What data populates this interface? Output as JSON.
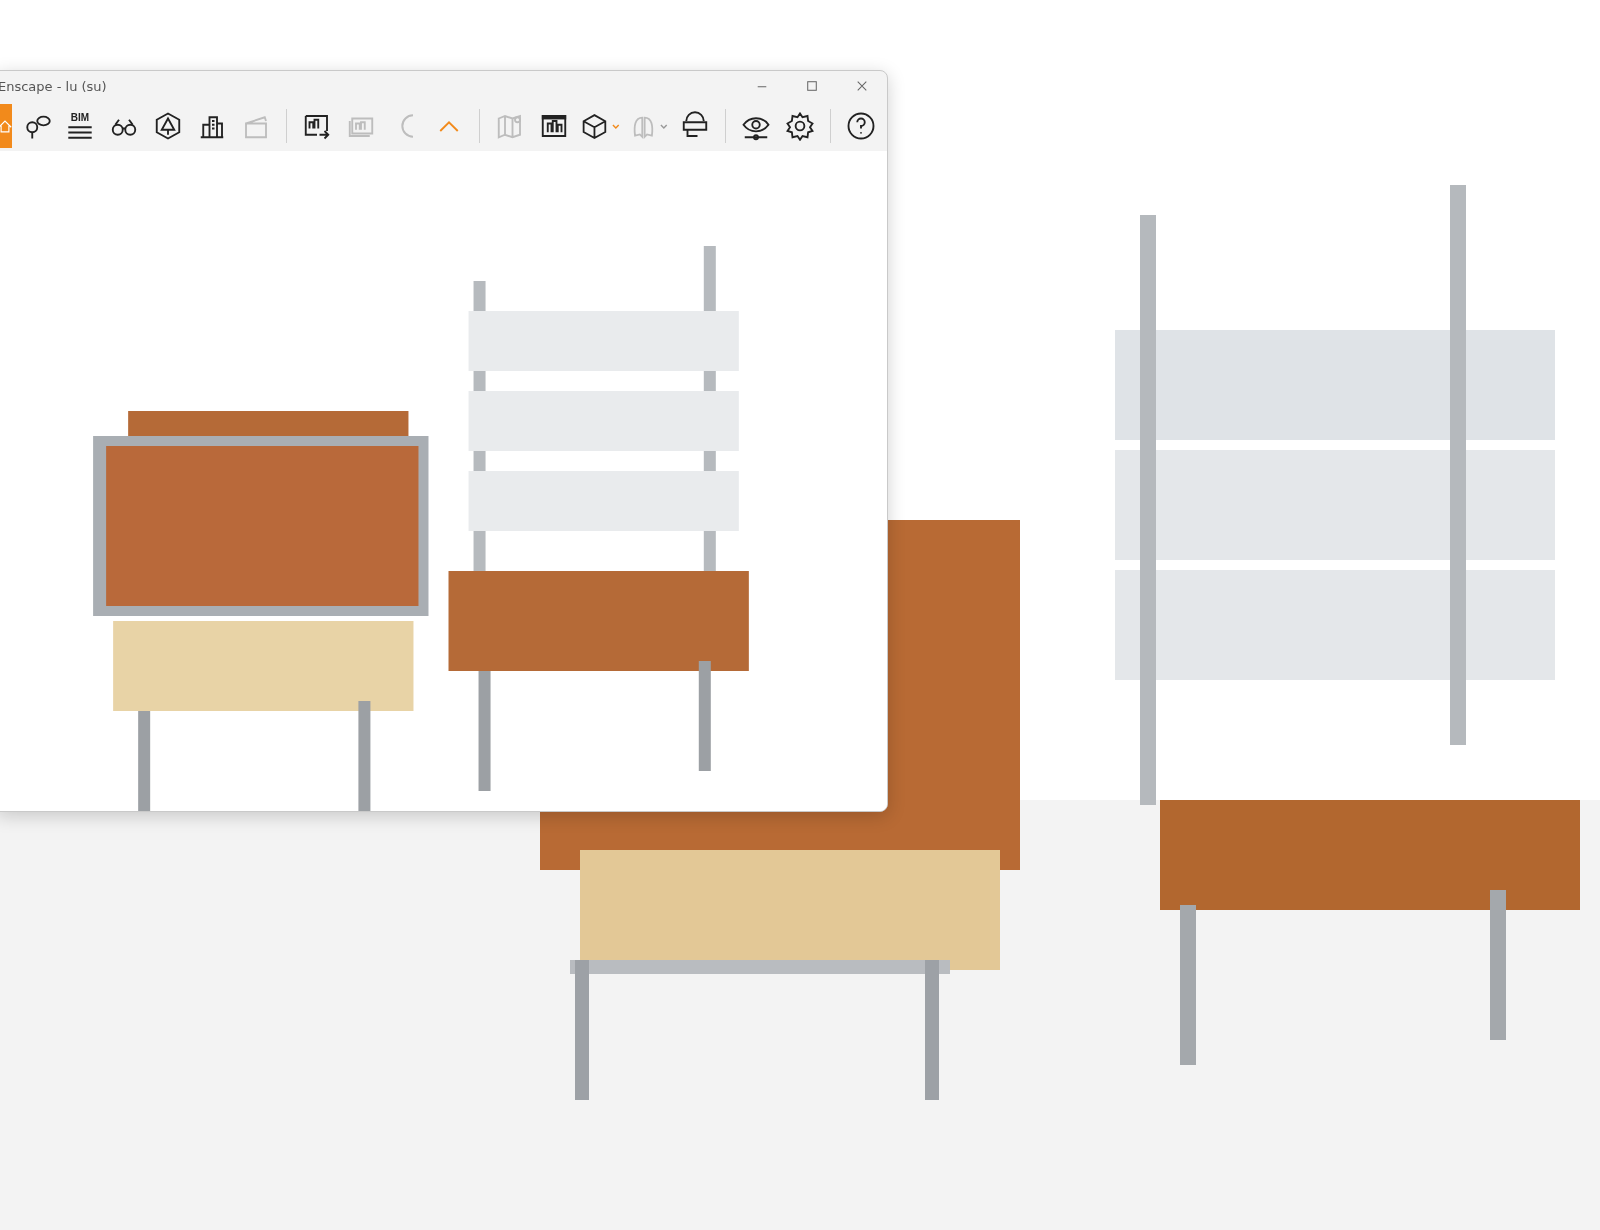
{
  "window": {
    "title": "Enscape - lu (su)"
  },
  "toolbar": [
    {
      "kind": "button",
      "selected": true,
      "disabled": false
    },
    {
      "kind": "button",
      "selected": false,
      "disabled": false
    },
    {
      "kind": "button",
      "selected": false,
      "disabled": false,
      "label": "BIM"
    },
    {
      "kind": "button",
      "selected": false,
      "disabled": false
    },
    {
      "kind": "button",
      "selected": false,
      "disabled": false
    },
    {
      "kind": "button",
      "selected": false,
      "disabled": false
    },
    {
      "kind": "button",
      "selected": false,
      "disabled": true
    },
    {
      "kind": "separator"
    },
    {
      "kind": "button",
      "selected": false,
      "disabled": false
    },
    {
      "kind": "button",
      "selected": false,
      "disabled": true
    },
    {
      "kind": "button",
      "selected": false,
      "disabled": true
    },
    {
      "kind": "expander",
      "selected": false
    },
    {
      "kind": "separator"
    },
    {
      "kind": "button",
      "selected": false,
      "disabled": true
    },
    {
      "kind": "button",
      "selected": false,
      "disabled": false
    },
    {
      "kind": "dropdown",
      "disabled": false
    },
    {
      "kind": "dropdown",
      "disabled": true
    },
    {
      "kind": "button",
      "selected": false,
      "disabled": false
    },
    {
      "kind": "separator"
    },
    {
      "kind": "button",
      "selected": false,
      "disabled": false
    },
    {
      "kind": "button",
      "selected": false,
      "disabled": false
    },
    {
      "kind": "separator"
    },
    {
      "kind": "button",
      "selected": false,
      "disabled": false
    }
  ]
}
